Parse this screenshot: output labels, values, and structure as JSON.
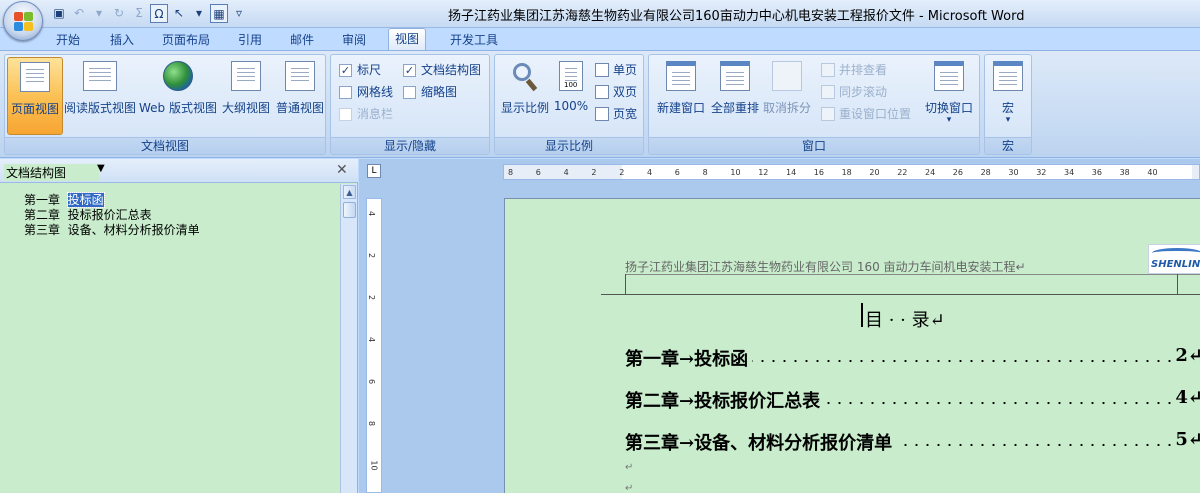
{
  "window": {
    "title": "扬子江药业集团江苏海慈生物药业有限公司160亩动力中心机电安装工程报价文件 - Microsoft Word"
  },
  "quick_access": [
    {
      "icon": "save-icon",
      "glyph": "▣"
    },
    {
      "icon": "undo-icon",
      "glyph": "↶"
    },
    {
      "icon": "undo-dropdown-icon",
      "glyph": "▾"
    },
    {
      "icon": "redo-icon",
      "glyph": "↻"
    },
    {
      "icon": "sum-icon",
      "glyph": "Σ"
    },
    {
      "icon": "omega-symbol-icon",
      "glyph": "Ω"
    },
    {
      "icon": "select-pointer-icon",
      "glyph": "↖"
    },
    {
      "icon": "pointer-dropdown-icon",
      "glyph": "▾"
    },
    {
      "icon": "equation-icon",
      "glyph": "▦"
    },
    {
      "icon": "customize-qat-icon",
      "glyph": "▿"
    }
  ],
  "tabs": [
    "开始",
    "插入",
    "页面布局",
    "引用",
    "邮件",
    "审阅",
    "视图",
    "开发工具"
  ],
  "active_tab": "视图",
  "ribbon": {
    "doc_views": {
      "label": "文档视图",
      "buttons": [
        "页面视图",
        "阅读版式视图",
        "Web 版式视图",
        "大纲视图",
        "普通视图"
      ]
    },
    "show_hide": {
      "label": "显示/隐藏",
      "ruler": "标尺",
      "gridlines": "网格线",
      "message_bar": "消息栏",
      "doc_map": "文档结构图",
      "thumbnails": "缩略图",
      "check": "✓"
    },
    "zoom": {
      "label": "显示比例",
      "zoom_btn": "显示比例",
      "hundred_btn": "100%",
      "hundred_icon_text": "100",
      "one_page": "单页",
      "two_pages": "双页",
      "page_width": "页宽"
    },
    "window": {
      "label": "窗口",
      "new_window": "新建窗口",
      "arrange_all": "全部重排",
      "split": "取消拆分",
      "side_by_side": "并排查看",
      "sync_scroll": "同步滚动",
      "reset_position": "重设窗口位置",
      "switch_windows": "切换窗口",
      "dropdown": "▾"
    },
    "macros": {
      "label": "宏",
      "macros_btn": "宏",
      "dropdown": "▾"
    }
  },
  "doc_map": {
    "title": "文档结构图",
    "dropdown": "▼",
    "close": "✕",
    "items": [
      {
        "chapter": "第一章",
        "name": "投标函"
      },
      {
        "chapter": "第二章",
        "name": "投标报价汇总表"
      },
      {
        "chapter": "第三章",
        "name": "设备、材料分析报价清单"
      }
    ]
  },
  "ruler": {
    "corner": "L",
    "h_ticks": [
      "8",
      "6",
      "4",
      "2",
      "2",
      "4",
      "6",
      "8",
      "10",
      "12",
      "14",
      "16",
      "18",
      "20",
      "22",
      "24",
      "26",
      "28",
      "30",
      "32",
      "34",
      "36",
      "38",
      "40"
    ],
    "v_ticks": [
      "4",
      "2",
      "2",
      "4",
      "6",
      "8",
      "10"
    ]
  },
  "document": {
    "header": "扬子江药业集团江苏海慈生物药业有限公司 160 亩动力车间机电安装工程↵",
    "logo_text": "SHENLING",
    "toc_title": "目  ·  ·  录↵",
    "toc": [
      {
        "label": "第一章→投标函",
        "page": "2↵"
      },
      {
        "label": "第二章→投标报价汇总表",
        "page": "4↵"
      },
      {
        "label": "第三章→设备、材料分析报价清单",
        "page": "5↵"
      }
    ],
    "para_mark": "↵"
  }
}
